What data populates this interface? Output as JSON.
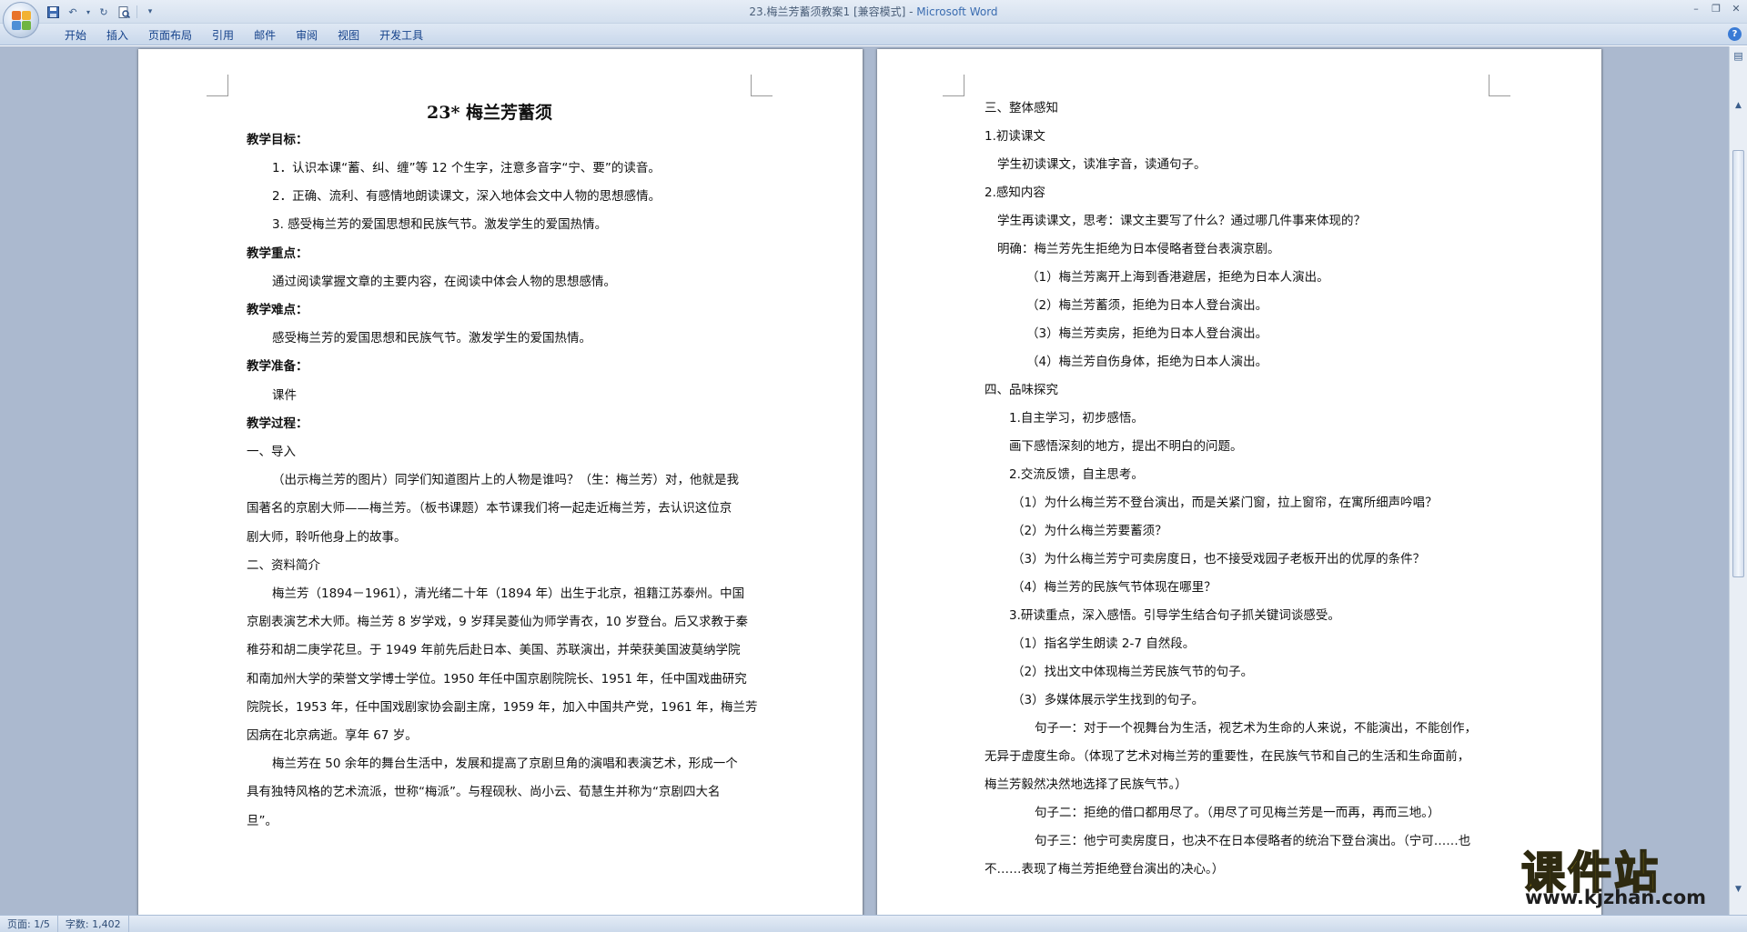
{
  "window": {
    "title": "23.梅兰芳蓄须教案1 [兼容模式] - ",
    "app_name": "Microsoft Word",
    "controls": [
      "minimize-icon",
      "restore-icon",
      "close-icon"
    ]
  },
  "quick_access": [
    "save-icon",
    "undo-icon",
    "redo-icon",
    "print-preview-icon",
    "customize-icon"
  ],
  "ribbon": {
    "tabs": [
      "开始",
      "插入",
      "页面布局",
      "引用",
      "邮件",
      "审阅",
      "视图",
      "开发工具"
    ]
  },
  "left_page": {
    "title": "23* 梅兰芳蓄须",
    "lines": [
      "教学目标：",
      "1．认识本课“蓄、纠、缠”等 12 个生字，注意多音字“宁、要”的读音。",
      "2．正确、流利、有感情地朗读课文，深入地体会文中人物的思想感情。",
      "3. 感受梅兰芳的爱国思想和民族气节。激发学生的爱国热情。",
      "教学重点：",
      "通过阅读掌握文章的主要内容，在阅读中体会人物的思想感情。",
      "教学难点：",
      "感受梅兰芳的爱国思想和民族气节。激发学生的爱国热情。",
      "教学准备：",
      "课件",
      "教学过程：",
      "一、导入",
      "（出示梅兰芳的图片）同学们知道图片上的人物是谁吗？（生：梅兰芳）对，他就是我",
      "国著名的京剧大师——梅兰芳。（板书课题）本节课我们将一起走近梅兰芳，去认识这位京",
      "剧大师，聆听他身上的故事。",
      "二、资料简介",
      "梅兰芳（1894－1961），清光绪二十年（1894 年）出生于北京，祖籍江苏泰州。中国",
      "京剧表演艺术大师。梅兰芳 8 岁学戏，9 岁拜吴菱仙为师学青衣，10 岁登台。后又求教于秦",
      "稚芬和胡二庚学花旦。于 1949 年前先后赴日本、美国、苏联演出，并荣获美国波莫纳学院",
      "和南加州大学的荣誉文学博士学位。1950 年任中国京剧院院长、1951 年，任中国戏曲研究",
      "院院长，1953 年，任中国戏剧家协会副主席，1959 年，加入中国共产党，1961 年，梅兰芳",
      "因病在北京病逝。享年 67 岁。",
      "梅兰芳在 50 余年的舞台生活中，发展和提高了京剧旦角的演唱和表演艺术，形成一个",
      "具有独特风格的艺术流派，世称“梅派”。与程砚秋、尚小云、荀慧生并称为“京剧四大名",
      "旦”。"
    ]
  },
  "right_page": {
    "lines": [
      "三、整体感知",
      "1.初读课文",
      "学生初读课文，读准字音，读通句子。",
      "2.感知内容",
      "学生再读课文，思考：课文主要写了什么？通过哪几件事来体现的？",
      "明确：梅兰芳先生拒绝为日本侵略者登台表演京剧。",
      "（1）梅兰芳离开上海到香港避居，拒绝为日本人演出。",
      "（2）梅兰芳蓄须，拒绝为日本人登台演出。",
      "（3）梅兰芳卖房，拒绝为日本人登台演出。",
      "（4）梅兰芳自伤身体，拒绝为日本人演出。",
      "四、品味探究",
      "1.自主学习，初步感悟。",
      "画下感悟深刻的地方，提出不明白的问题。",
      "2.交流反馈，自主思考。",
      "（1）为什么梅兰芳不登台演出，而是关紧门窗，拉上窗帘，在寓所细声吟唱？",
      "（2）为什么梅兰芳要蓄须？",
      "（3）为什么梅兰芳宁可卖房度日，也不接受戏园子老板开出的优厚的条件？",
      "（4）梅兰芳的民族气节体现在哪里？",
      "3.研读重点，深入感悟。引导学生结合句子抓关键词谈感受。",
      "（1）指名学生朗读 2-7 自然段。",
      "（2）找出文中体现梅兰芳民族气节的句子。",
      "（3）多媒体展示学生找到的句子。",
      "句子一：对于一个视舞台为生活，视艺术为生命的人来说，不能演出，不能创作，",
      "无异于虚度生命。（体现了艺术对梅兰芳的重要性，在民族气节和自己的生活和生命面前，",
      "梅兰芳毅然决然地选择了民族气节。）",
      "句子二：拒绝的借口都用尽了。（用尽了可见梅兰芳是一而再，再而三地。）",
      "句子三：他宁可卖房度日，也决不在日本侵略者的统治下登台演出。（宁可……也",
      "不……表现了梅兰芳拒绝登台演出的决心。）"
    ]
  },
  "statusbar": {
    "page": "页面: 1/5",
    "words": "字数: 1,402"
  },
  "watermark": {
    "main": "课件站",
    "url": "www.kjzhan.com"
  }
}
